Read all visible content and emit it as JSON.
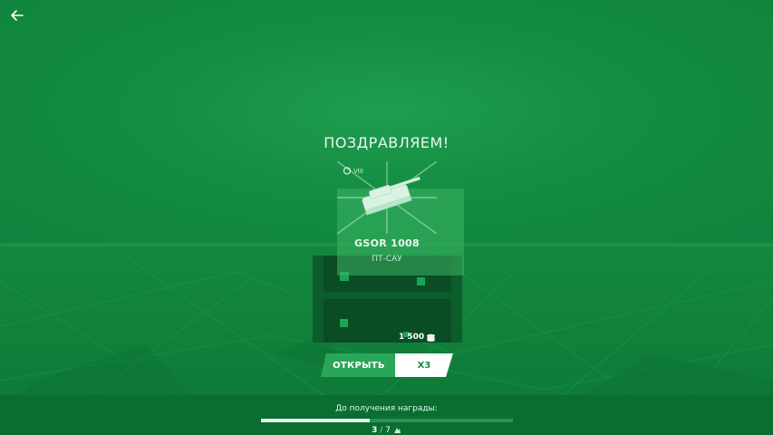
{
  "header": {
    "back_icon": "arrow-left-icon"
  },
  "reward": {
    "title": "ПОЗДРАВЛЯЕМ!",
    "tier": "VIII",
    "tank_name": "GSOR 1008",
    "tank_class": "ПТ-САУ",
    "price": "1 500",
    "price_icon": "silver-coins-icon"
  },
  "actions": {
    "open_label": "ОТКРЫТЬ",
    "multiplier_label": "X3"
  },
  "progress": {
    "label": "До получения награды:",
    "current": "3",
    "separator": "/",
    "total": "7",
    "fraction": 0.43,
    "icon": "reward-icon"
  },
  "colors": {
    "background": "#118a40",
    "accent_white": "#ffffff",
    "button_green": "#2aa65a"
  }
}
